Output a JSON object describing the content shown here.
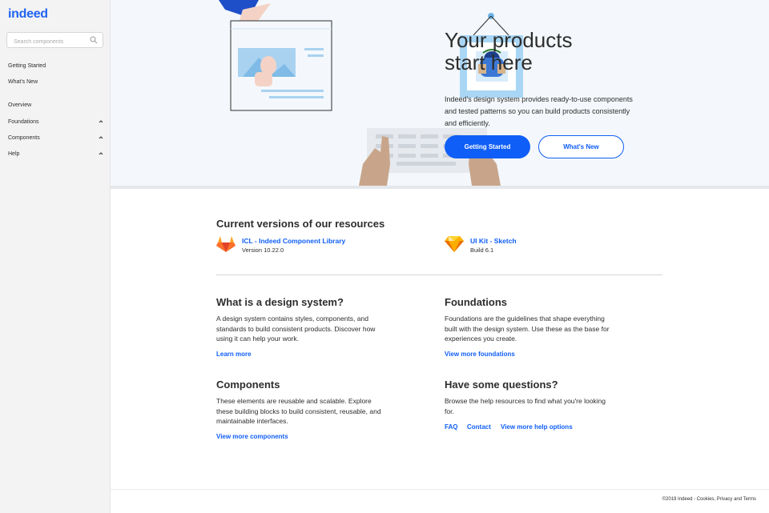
{
  "sidebar": {
    "logo": "indeed",
    "search_placeholder": "Search components",
    "items": [
      {
        "label": "Getting Started"
      },
      {
        "label": "What's New"
      },
      {
        "label": "Overview"
      },
      {
        "label": "Foundations"
      },
      {
        "label": "Components"
      },
      {
        "label": "Help"
      }
    ]
  },
  "hero": {
    "title_line1": "Your products",
    "title_line2": "start here",
    "description": "Indeed's design system provides ready-to-use components and tested patterns so you can build products consistently and efficiently.",
    "primary_button": "Getting Started",
    "secondary_button": "What's New"
  },
  "resources": {
    "heading": "Current versions of our resources",
    "items": [
      {
        "title": "ICL - Indeed Component Library",
        "subtitle": "Version 10.22.0",
        "icon": "gitlab-icon"
      },
      {
        "title": "UI Kit - Sketch",
        "subtitle": "Build 6.1",
        "icon": "sketch-icon"
      }
    ]
  },
  "blocks": {
    "design_system": {
      "title": "What is a design system?",
      "text": "A design system contains styles, components, and standards to build consistent products. Discover how using it can help your work.",
      "link": "Learn more"
    },
    "foundations": {
      "title": "Foundations",
      "text": "Foundations are the guidelines that shape everything built with the design system. Use these as the base for experiences you create.",
      "link": "View more foundations"
    },
    "components": {
      "title": "Components",
      "text": "These elements are reusable and scalable. Explore these building blocks to build consistent, reusable, and maintainable interfaces.",
      "link": "View more components"
    },
    "questions": {
      "title": "Have some questions?",
      "text": "Browse the help resources to find what you're looking for.",
      "links": [
        "FAQ",
        "Contact",
        "View more help options"
      ]
    }
  },
  "footer": {
    "text": "©2019 Indeed - Cookies, Privacy and Terms"
  },
  "colors": {
    "brand_blue": "#0f5ef7",
    "sidebar_bg": "#f3f3f3",
    "hero_bg": "#f4f8fc"
  }
}
